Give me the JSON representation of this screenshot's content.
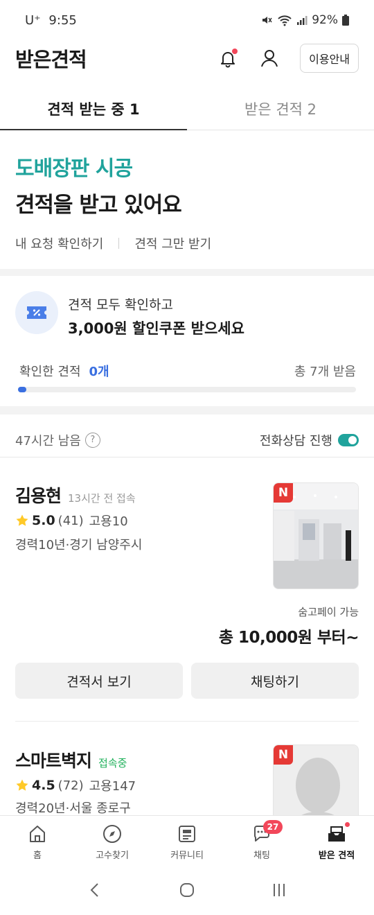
{
  "status_bar": {
    "carrier": "U⁺",
    "time": "9:55",
    "battery": "92%"
  },
  "header": {
    "title": "받은견적",
    "guide_label": "이용안내"
  },
  "tabs": [
    {
      "label": "견적 받는 중 1",
      "active": true
    },
    {
      "label": "받은 견적 2",
      "active": false
    }
  ],
  "hero": {
    "service": "도배장판 시공",
    "status": "견적을 받고 있어요",
    "link_view_request": "내 요청 확인하기",
    "link_stop": "견적 그만 받기"
  },
  "coupon": {
    "line1": "견적 모두 확인하고",
    "line2": "3,000원 할인쿠폰 받으세요",
    "checked_label": "확인한 견적",
    "checked_count": "0개",
    "total_label": "총 7개 받음",
    "progress_fraction": 0.02
  },
  "info": {
    "time_left": "47시간 남음",
    "help": "?",
    "phone_consult": "전화상담 진행",
    "phone_consult_on": true
  },
  "pros": [
    {
      "name": "김용현",
      "access": "13시간 전 접속",
      "rating": "5.0",
      "reviews": "(41)",
      "hires": "고용10",
      "career": "경력10년·경기 남양주시",
      "badge": "N",
      "pay": "숨고페이 가능",
      "price": "총 10,000원 부터~",
      "btn_quote": "견적서 보기",
      "btn_chat": "채팅하기"
    },
    {
      "name": "스마트벽지",
      "access": "접속중",
      "rating": "4.5",
      "reviews": "(72)",
      "hires": "고용147",
      "career": "경력20년·서울 종로구",
      "badge": "N"
    }
  ],
  "bottom_nav": [
    {
      "label": "홈",
      "icon": "home-icon"
    },
    {
      "label": "고수찾기",
      "icon": "compass-icon"
    },
    {
      "label": "커뮤니티",
      "icon": "community-icon"
    },
    {
      "label": "채팅",
      "icon": "chat-icon",
      "badge": "27"
    },
    {
      "label": "받은 견적",
      "icon": "inbox-icon",
      "active": true
    }
  ],
  "colors": {
    "accent": "#20a39c",
    "blue": "#3a6fe0",
    "red": "#f2475a",
    "badge": "#e53935"
  }
}
